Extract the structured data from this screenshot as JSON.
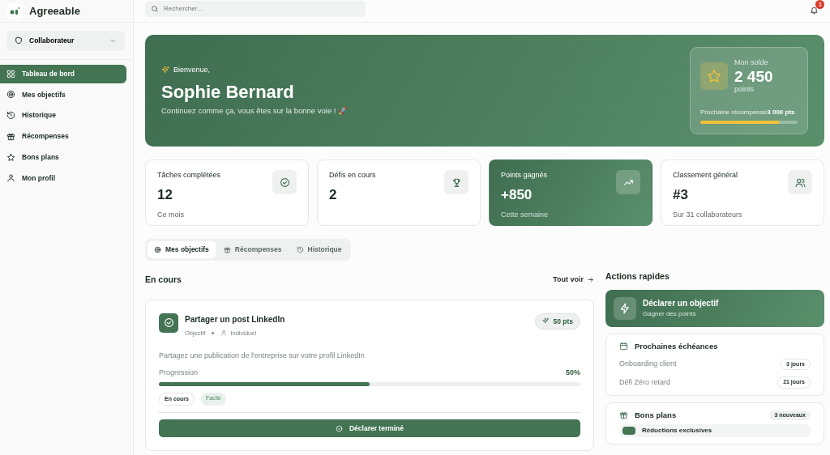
{
  "app": {
    "name": "Agreeable"
  },
  "role_selector": {
    "label": "Collaborateur"
  },
  "sidebar": {
    "items": [
      {
        "label": "Tableau de bord",
        "selected": true
      },
      {
        "label": "Mes objectifs",
        "selected": false
      },
      {
        "label": "Historique",
        "selected": false
      },
      {
        "label": "Récompenses",
        "selected": false
      },
      {
        "label": "Bons plans",
        "selected": false
      },
      {
        "label": "Mon profil",
        "selected": false
      }
    ]
  },
  "search": {
    "placeholder": "Rechercher..."
  },
  "notifications": {
    "count": "3"
  },
  "hero": {
    "greeting": "Bienvenue,",
    "name": "Sophie Bernard",
    "message": "Continuez comme ça, vous êtes sur la bonne voie ! 🚀",
    "balance": {
      "label": "Mon solde",
      "value": "2 450",
      "unit": "points",
      "next_label": "Prochaine récompense",
      "next_value": "3 000 pts",
      "level": 0.82
    }
  },
  "stats": [
    {
      "label": "Tâches complétées",
      "value": "12",
      "note": "Ce mois",
      "highlight": false
    },
    {
      "label": "Défis en cours",
      "value": "2",
      "highlight": false
    },
    {
      "label": "Points gagnés",
      "value": "+850",
      "note": "Cette semaine",
      "highlight": true
    },
    {
      "label": "Classement général",
      "value": "#3",
      "note": "Sur 31 collaborateurs",
      "highlight": false
    }
  ],
  "tabs": [
    {
      "label": "Mes objectifs",
      "selected": true
    },
    {
      "label": "Récompenses",
      "selected": false
    },
    {
      "label": "Historique",
      "selected": false
    }
  ],
  "in_progress": {
    "title": "En cours",
    "see_all": "Tout voir",
    "items": [
      {
        "title": "Partager un post LinkedIn",
        "type": "Objectif",
        "scope": "Individuel",
        "points": "50 pts",
        "description": "Partagez une publication de l'entreprise sur votre profil LinkedIn",
        "progress_label": "Progression",
        "progress_text": "50%",
        "level": 0.5,
        "status": "En cours",
        "difficulty": "Facile",
        "action": "Déclarer terminé"
      }
    ]
  },
  "quick_actions": {
    "title": "Actions rapides",
    "primary": {
      "title": "Déclarer un objectif",
      "subtitle": "Gagner des points"
    },
    "deadlines": {
      "title": "Prochaines échéances",
      "items": [
        {
          "label": "Onboarding client",
          "due": "3 jours"
        },
        {
          "label": "Défi Zéro retard",
          "due": "21 jours"
        }
      ]
    },
    "deals": {
      "title": "Bons plans",
      "badge": "3 nouveaux",
      "items": [
        {
          "title": "Réductions exclusives"
        }
      ]
    }
  }
}
